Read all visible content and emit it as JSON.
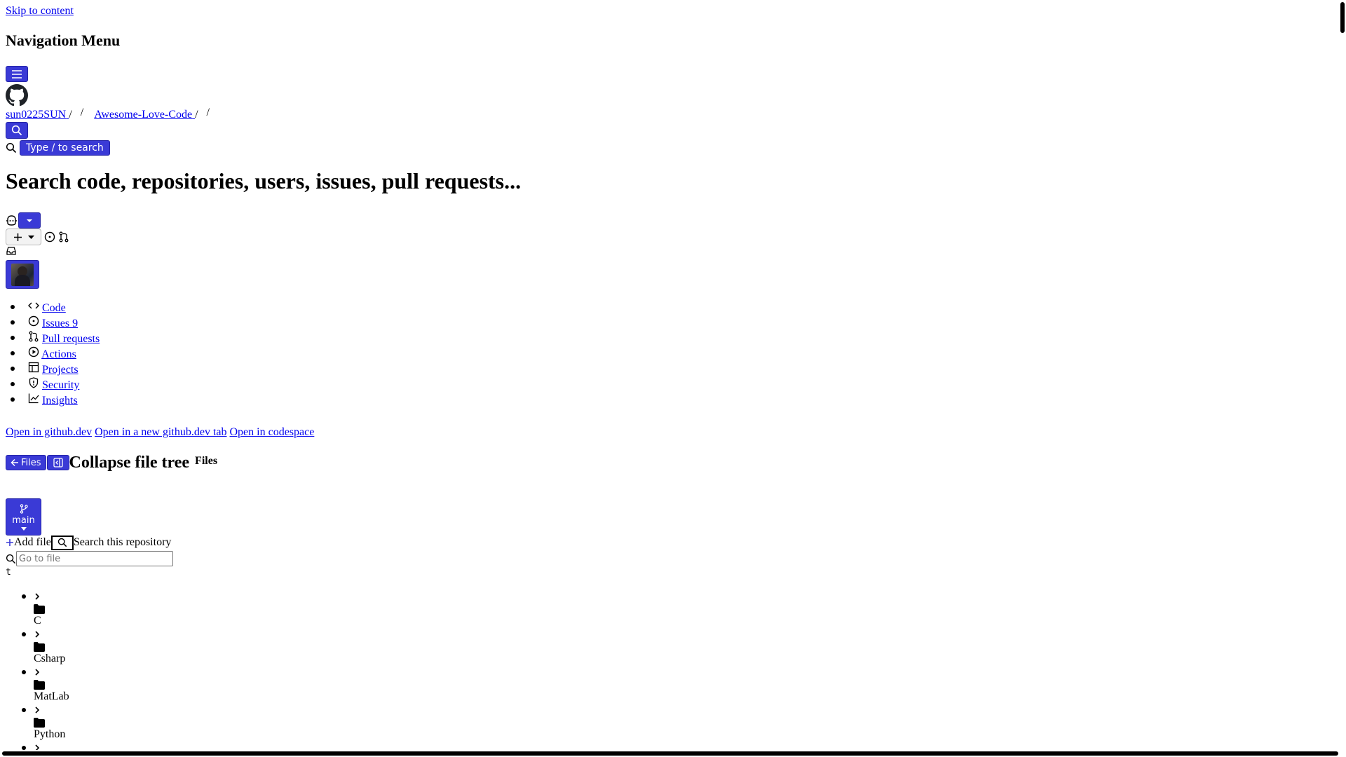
{
  "skip_link": "Skip to content",
  "nav_heading": "Navigation Menu",
  "breadcrumb": {
    "owner": "sun0225SUN",
    "repo": "Awesome-Love-Code",
    "sep": "/"
  },
  "search": {
    "type_hint": "Type / to search",
    "heading": "Search code, repositories, users, issues, pull requests..."
  },
  "repo_nav": [
    {
      "label": "Code",
      "icon": "code-icon"
    },
    {
      "label": "Issues 9",
      "icon": "issue-icon"
    },
    {
      "label": "Pull requests",
      "icon": "pull-request-icon"
    },
    {
      "label": "Actions",
      "icon": "play-icon"
    },
    {
      "label": "Projects",
      "icon": "table-icon"
    },
    {
      "label": "Security",
      "icon": "shield-icon"
    },
    {
      "label": "Insights",
      "icon": "graph-icon"
    }
  ],
  "open_links": {
    "github_dev": "Open in github.dev",
    "new_tab": "Open in a new github.dev tab",
    "codespace": "Open in codespace"
  },
  "file_tree": {
    "files_button": "Files",
    "collapse_heading": "Collapse file tree",
    "files_label": "Files",
    "branch": "main",
    "add_file": "Add file",
    "search_repo": "Search this repository",
    "go_to_file_placeholder": "Go to file",
    "shortcut": "t",
    "folders": [
      "C",
      "Csharp",
      "MatLab",
      "Python"
    ]
  },
  "colors": {
    "button_bg": "#3a3ad6",
    "link": "#0000ee"
  }
}
